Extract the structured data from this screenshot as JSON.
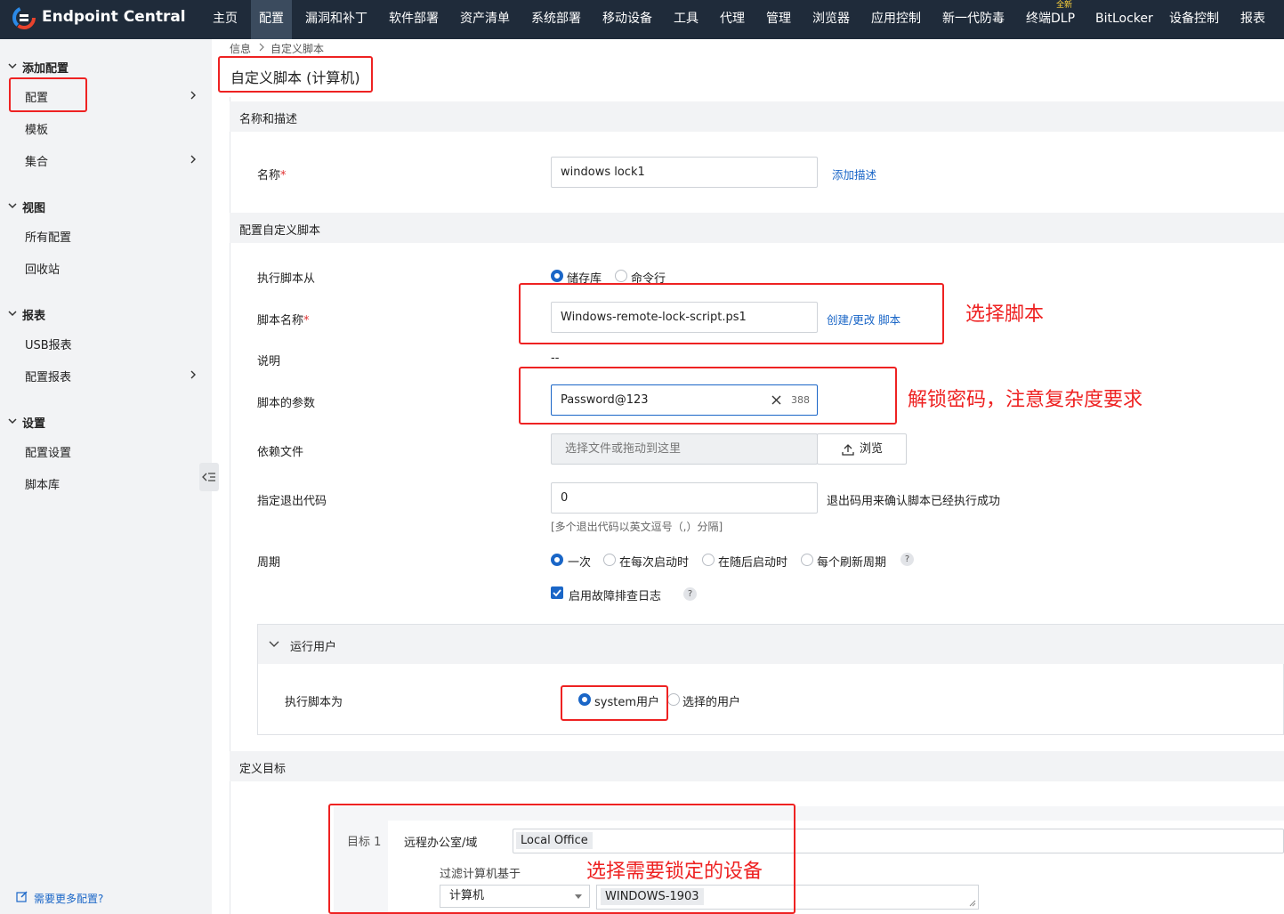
{
  "app": {
    "brand": "Endpoint Central"
  },
  "nav": {
    "items": [
      {
        "label": "主页"
      },
      {
        "label": "配置"
      },
      {
        "label": "漏洞和补丁"
      },
      {
        "label": "软件部署"
      },
      {
        "label": "资产清单"
      },
      {
        "label": "系统部署"
      },
      {
        "label": "移动设备"
      },
      {
        "label": "工具"
      },
      {
        "label": "代理"
      },
      {
        "label": "管理"
      },
      {
        "label": "浏览器"
      },
      {
        "label": "应用控制"
      },
      {
        "label": "新一代防毒"
      },
      {
        "label": "终端DLP"
      },
      {
        "label": "BitLocker"
      },
      {
        "label": "设备控制"
      },
      {
        "label": "报表"
      }
    ],
    "active": "配置",
    "new_badge": "全新"
  },
  "sidebar": {
    "groups": [
      {
        "title": "添加配置",
        "items": [
          "配置",
          "模板",
          "集合"
        ]
      },
      {
        "title": "视图",
        "items": [
          "所有配置",
          "回收站"
        ]
      },
      {
        "title": "报表",
        "items": [
          "USB报表",
          "配置报表"
        ]
      },
      {
        "title": "设置",
        "items": [
          "配置设置",
          "脚本库"
        ]
      }
    ],
    "more_link": "需要更多配置?"
  },
  "breadcrumb": {
    "parent": "信息",
    "current": "自定义脚本"
  },
  "page_title": "自定义脚本 (计算机)",
  "sections": {
    "name_desc": "名称和描述",
    "config_script": "配置自定义脚本",
    "define_target": "定义目标"
  },
  "form": {
    "name_label": "名称",
    "name_value": "windows lock1",
    "add_desc_link": "添加描述",
    "exec_from_label": "执行脚本从",
    "exec_from_options": [
      "储存库",
      "命令行"
    ],
    "script_name_label": "脚本名称",
    "script_name_value": "Windows-remote-lock-script.ps1",
    "create_script_link": "创建/更改 脚本",
    "desc_label": "说明",
    "desc_value": "--",
    "params_label": "脚本的参数",
    "params_value": "Password@123",
    "params_counter": "388",
    "dep_label": "依赖文件",
    "dep_placeholder": "选择文件或拖动到这里",
    "browse_label": "浏览",
    "exit_label": "指定退出代码",
    "exit_value": "0",
    "exit_help": "退出码用来确认脚本已经执行成功",
    "exit_hint": "[多个退出代码以英文逗号（,）分隔]",
    "period_label": "周期",
    "period_options": [
      "一次",
      "在每次启动时",
      "在随后启动时",
      "每个刷新周期"
    ],
    "log_label": "启用故障排查日志",
    "run_user_title": "运行用户",
    "exec_as_label": "执行脚本为",
    "exec_as_options": [
      "system用户",
      "选择的用户"
    ]
  },
  "target": {
    "label": "目标 1",
    "office_label": "远程办公室/域",
    "office_value": "Local Office",
    "filter_label": "过滤计算机基于",
    "filter_value": "计算机",
    "computer_value": "WINDOWS-1903"
  },
  "annotations": {
    "select_script": "选择脚本",
    "unlock_password": "解锁密码，注意复杂度要求",
    "select_device": "选择需要锁定的设备"
  },
  "colors": {
    "annotation": "#e22222",
    "accent": "#1a66c7",
    "topbar": "#1f2b3a"
  }
}
